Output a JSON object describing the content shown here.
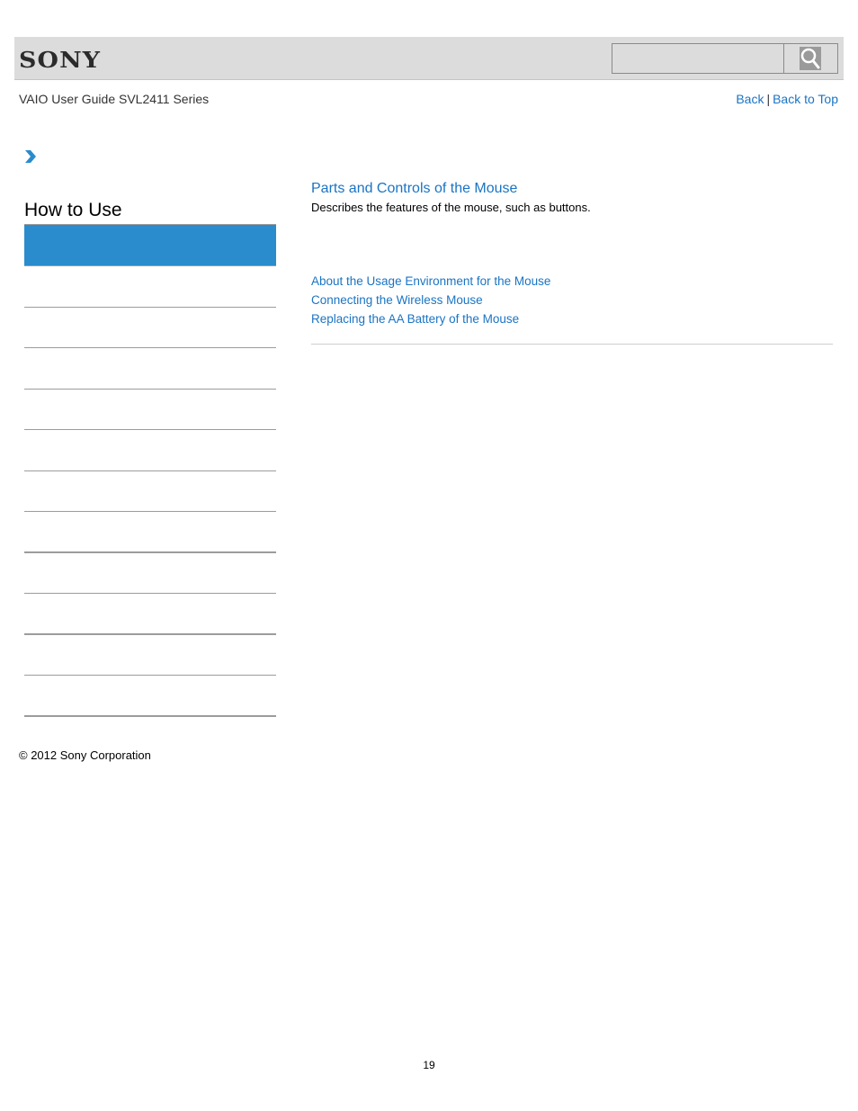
{
  "header": {
    "logo": "SONY",
    "search": {
      "placeholder": "",
      "value": "",
      "button_icon": "search-icon"
    }
  },
  "subheader": {
    "guide_title": "VAIO User Guide SVL2411 Series",
    "nav": {
      "back": "Back",
      "separator": "|",
      "back_to_top": "Back to Top"
    }
  },
  "breadcrumb": {
    "icon": "chevron-right-icon"
  },
  "sidebar": {
    "title": "How to Use",
    "active_color": "#2a8ccc",
    "items": [
      {
        "label": "",
        "active": true
      },
      {
        "label": ""
      },
      {
        "label": ""
      },
      {
        "label": ""
      },
      {
        "label": ""
      },
      {
        "label": ""
      },
      {
        "label": ""
      },
      {
        "label": ""
      },
      {
        "label": ""
      },
      {
        "label": ""
      },
      {
        "label": ""
      },
      {
        "label": ""
      }
    ]
  },
  "main": {
    "topic": {
      "title": "Parts and Controls of the Mouse",
      "description": "Describes the features of the mouse, such as buttons."
    },
    "related_links": [
      "About the Usage Environment for the Mouse",
      "Connecting the Wireless Mouse",
      "Replacing the AA Battery of the Mouse"
    ]
  },
  "footer": {
    "copyright": "© 2012 Sony Corporation",
    "page_number": "19"
  },
  "colors": {
    "link": "#1a74c4",
    "header_bg": "#dcdcdc"
  }
}
